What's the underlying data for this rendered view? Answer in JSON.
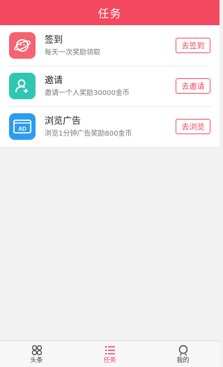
{
  "header": {
    "title": "任务"
  },
  "colors": {
    "accent": "#f3485f",
    "signin_icon_bg": "#f4636f",
    "invite_icon_bg": "#2fc7b1",
    "ads_icon_bg": "#2e9bf0"
  },
  "tasks": [
    {
      "icon": "planet-icon",
      "title": "签到",
      "desc": "每天一次奖励领取",
      "button": "去签到"
    },
    {
      "icon": "user-add-icon",
      "title": "邀请",
      "desc": "邀请一个人奖励30000金币",
      "button": "去邀请"
    },
    {
      "icon": "ad-icon",
      "title": "浏览广告",
      "desc": "浏览1分钟广告奖励800金币",
      "button": "去浏览"
    }
  ],
  "ad_icon_text": "AD",
  "tabbar": {
    "tabs": [
      {
        "label": "头条",
        "icon": "grid-icon",
        "active": false
      },
      {
        "label": "任务",
        "icon": "list-icon",
        "active": true
      },
      {
        "label": "我的",
        "icon": "person-icon",
        "active": false
      }
    ]
  }
}
